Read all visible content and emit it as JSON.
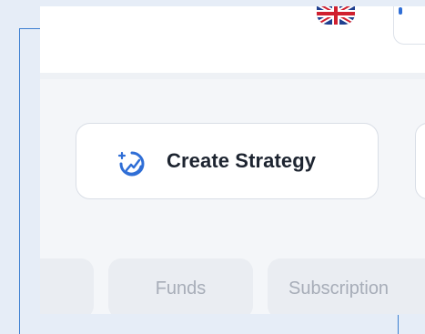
{
  "header": {
    "language_icon": "uk-flag-icon"
  },
  "main": {
    "create_strategy": {
      "label": "Create Strategy",
      "icon": "strategy-gauge-icon",
      "icon_color": "#2f6ed6"
    }
  },
  "tabs": [
    {
      "label": ""
    },
    {
      "label": "Funds"
    },
    {
      "label": "Subscription"
    }
  ],
  "colors": {
    "accent": "#2f6ed6",
    "bracket": "#3d7fd1"
  }
}
